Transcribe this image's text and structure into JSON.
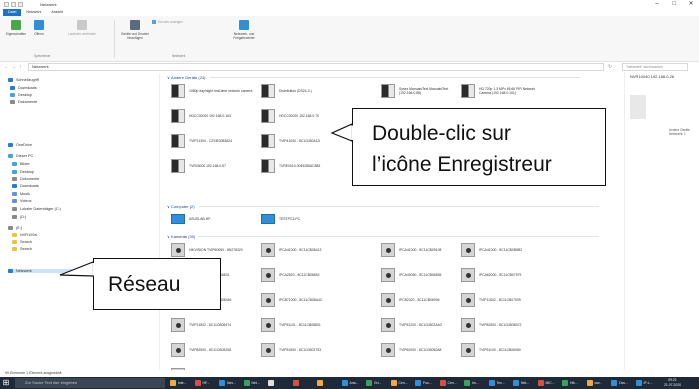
{
  "window": {
    "title": "Netzwerk",
    "controls": [
      "–",
      "□",
      "✕"
    ]
  },
  "ribbon": {
    "tabs": [
      "Datei",
      "Netzwerk",
      "Ansicht"
    ],
    "items": {
      "properties": "Eigenschaften",
      "open": "Öffnen",
      "drive": "Laufwerk verbinden",
      "media": "Geräte und Drucker hinzufügen",
      "view_devices": "Drucker anzeigen",
      "control_center": "Netzwerk- und Freigabecenter"
    },
    "groups": [
      "Speicherort",
      "Netzwerk"
    ]
  },
  "address": {
    "path": "Netzwerk",
    "search_placeholder": "\"Netzwerk\" durchsuchen"
  },
  "sidebar": {
    "items": [
      {
        "label": "Schnellzugriff",
        "color": "#2b7bd3"
      },
      {
        "label": "Downloads",
        "color": "#2b7bd3"
      },
      {
        "label": "Desktop",
        "color": "#4aa0e6"
      },
      {
        "label": "Dokumente",
        "color": "#8a8a8a"
      },
      {
        "label": "OneDrive",
        "color": "#2b7bd3"
      },
      {
        "label": "Dieser PC",
        "color": "#4aa0e6"
      },
      {
        "label": "Bilder",
        "color": "#4aa0e6"
      },
      {
        "label": "Desktop",
        "color": "#4aa0e6"
      },
      {
        "label": "Dokumente",
        "color": "#8a8a8a"
      },
      {
        "label": "Downloads",
        "color": "#2b7bd3"
      },
      {
        "label": "Musik",
        "color": "#6a8fd6"
      },
      {
        "label": "Videos",
        "color": "#6a8fd6"
      },
      {
        "label": "Lokaler Datenträger (C:)",
        "color": "#8a8a8a"
      },
      {
        "label": "(D:)",
        "color": "#8a8a8a"
      },
      {
        "label": "(E:)",
        "color": "#8a8a8a"
      },
      {
        "label": "NVR100xI",
        "color": "#e8c34a"
      },
      {
        "label": "Search",
        "color": "#e8c34a"
      },
      {
        "label": "Search",
        "color": "#e8c34a"
      },
      {
        "label": "Netzwerk",
        "color": "#2b7bd3"
      }
    ]
  },
  "sections": {
    "other": "Andere Geräte (24)",
    "computers": "Computer (2)",
    "cameras": "Kameras (30)"
  },
  "other_devices": [
    {
      "label": "1080p day/night real-time network camera",
      "icon": "server"
    },
    {
      "label": "Distribution (DS24-3-)",
      "icon": "server"
    },
    {
      "label": "Sysex ManualsText ManualsText (192.168.0.88)",
      "icon": "server"
    },
    {
      "label": "HD 720p 1.3 MPx 65.66 PIR Network Camera (192.168.0.101)",
      "icon": "server"
    },
    {
      "label": "HDCC00020 192.168.0.163",
      "icon": "server"
    },
    {
      "label": "HDCC00020 192.168.0.70",
      "icon": "server"
    },
    {
      "label": "NVR1000 192.168.0.34",
      "icon": "server"
    },
    {
      "label": "NVR10040 192.168.0.26",
      "icon": "server",
      "selected": true
    },
    {
      "label": "TVIP21300 - C2SIE0083824",
      "icon": "server"
    },
    {
      "label": "TVIP41000 - 8C11CB0A1D",
      "icon": "server"
    },
    {
      "label": "TVIP61000 - 8C11CB0D007",
      "icon": "server"
    },
    {
      "label": "TVIP61000 - 8C11CB0BA76",
      "icon": "server"
    },
    {
      "label": "TVR43000 192.168.0.57",
      "icon": "server"
    },
    {
      "label": "TVRE0010-0049285AC883",
      "icon": "server"
    }
  ],
  "computers": [
    {
      "label": "ASUSLAB-HP",
      "icon": "pc"
    },
    {
      "label": "TESTPC3-PC",
      "icon": "pc"
    }
  ],
  "cameras": [
    {
      "label": "HIKVISION TVIP60050 - 8N278320",
      "icon": "cam"
    },
    {
      "label": "IPCA41000 - 8C11CB08413",
      "icon": "cam"
    },
    {
      "label": "IPCA41000 - 8C11CB09108",
      "icon": "cam"
    },
    {
      "label": "IPCA41000 - 8C11CB0B8B2",
      "icon": "cam"
    },
    {
      "label": "IPCA2520 - 8C11CB06831",
      "icon": "cam"
    },
    {
      "label": "IPCA2520 - 8C11CB06852",
      "icon": "cam"
    },
    {
      "label": "IPCA40050 - 8C11CB06835",
      "icon": "cam"
    },
    {
      "label": "IPCA62000 - 8C11CB07979",
      "icon": "cam"
    },
    {
      "label": "IPCB71000 - 8C11CB08446",
      "icon": "cam"
    },
    {
      "label": "IPCB71000 - 8C11CB08A4C",
      "icon": "cam"
    },
    {
      "label": "IPCB2320 - 8C11CB06906",
      "icon": "cam"
    },
    {
      "label": "TVIP11502 - 8C11CB07009",
      "icon": "cam"
    },
    {
      "label": "TVIP21502 - 8C11CB06974",
      "icon": "cam"
    },
    {
      "label": "TVIP51101 - 8C11CB08801",
      "icon": "cam"
    },
    {
      "label": "TVIP51200 - 8C11CB02AA3",
      "icon": "cam"
    },
    {
      "label": "TVIP82500 - 8C11CB05B72",
      "icon": "cam"
    },
    {
      "label": "TVIP82500 - 8C11CB05208",
      "icon": "cam"
    },
    {
      "label": "TVIP51500 - 8C11CB03793",
      "icon": "cam"
    },
    {
      "label": "TVIP62000 - 8C11CB050A8",
      "icon": "cam"
    },
    {
      "label": "TVIP91100 - 8C11CB06080",
      "icon": "cam"
    },
    {
      "label": "TVIP91000 - 8C11CB06389",
      "icon": "cam"
    }
  ],
  "preview": {
    "title": "NVR10040 192.168.0.26",
    "sub1": "Andere Geräte",
    "sub2": "Netzwerk: 1"
  },
  "status": "59 Elemente   1 Element ausgewählt",
  "taskbar": {
    "search": "Zur Suche Text hier eingeben",
    "apps": [
      "Inte...",
      "HF...",
      "Nex...",
      "Net...",
      "",
      "",
      "",
      "Ana...",
      "Gri...",
      "Cen...",
      "Foo...",
      "Cen...",
      "Im...",
      "Tex...",
      "Net...",
      "MIC...",
      "Hik...",
      "ww...",
      "Ocu...",
      "IP-L..."
    ],
    "time": "09:21",
    "date": "21.07.2020"
  },
  "callouts": {
    "enregistreur_line1": "Double-clic sur",
    "enregistreur_line2": "l’icône Enregistreur",
    "reseau": "Réseau"
  }
}
